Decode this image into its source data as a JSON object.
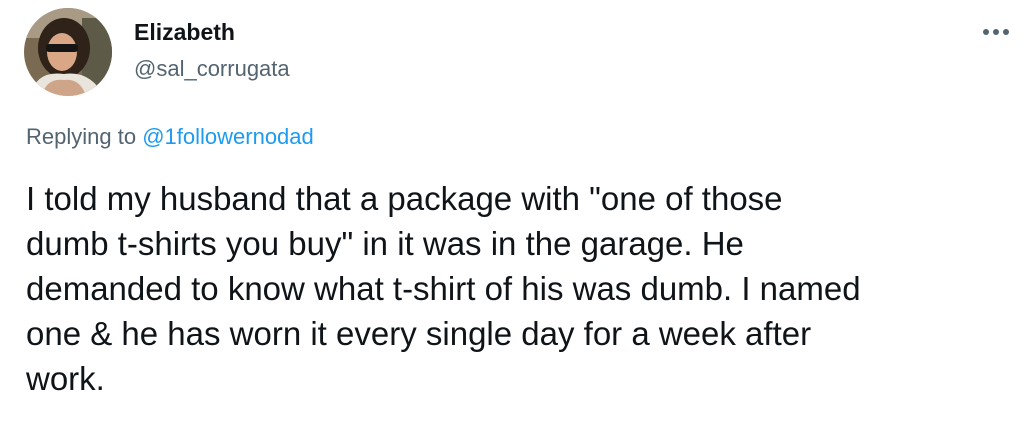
{
  "author": {
    "display_name": "Elizabeth",
    "handle": "@sal_corrugata"
  },
  "more_icon": "more-horizontal-icon",
  "reply": {
    "prefix": "Replying to",
    "mention": "@1followernodad"
  },
  "tweet": {
    "text": "I told my husband that a package with \"one of those\ndumb t-shirts you buy\" in it was in the garage. He\ndemanded to know what t-shirt of his was dumb. I named\none & he has worn it every single day for a week after\nwork."
  },
  "colors": {
    "text_primary": "#0f1419",
    "text_secondary": "#536471",
    "link": "#1d9bf0"
  }
}
